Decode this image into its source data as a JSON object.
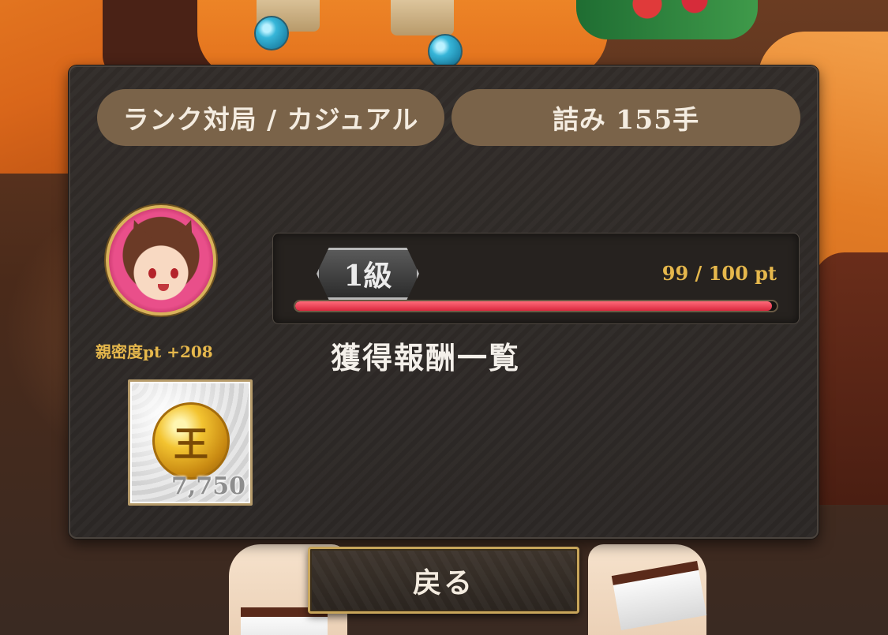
{
  "header": {
    "mode_label": "ランク対局 / カジュアル",
    "puzzle_label": "詰み 155手"
  },
  "character": {
    "affection_label": "親密度pt +208"
  },
  "rank": {
    "badge": "1級",
    "points_text": "99 / 100 pt",
    "progress_fraction": 0.99
  },
  "rewards": {
    "heading": "獲得報酬一覧",
    "items": [
      {
        "icon": "gold-coin-icon",
        "amount": "7,750"
      }
    ]
  },
  "footer": {
    "back_label": "戻る"
  },
  "colors": {
    "pill_bg": "#7a6349",
    "accent_gold": "#e6b84c",
    "progress_red": "#d8283e",
    "panel_bg": "#2b2725"
  }
}
